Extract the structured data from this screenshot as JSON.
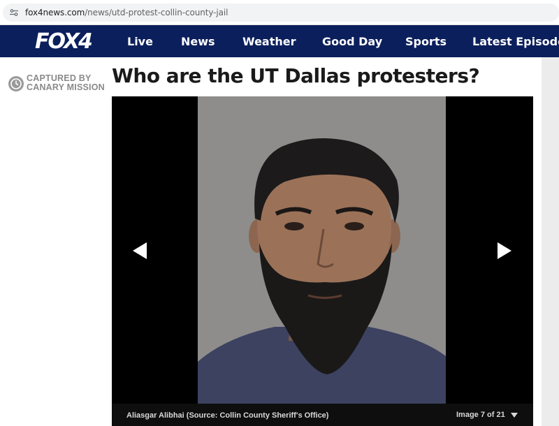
{
  "browser": {
    "url_host": "fox4news.com",
    "url_path": "/news/utd-protest-collin-county-jail"
  },
  "nav": {
    "logo": "FOX4",
    "items": [
      {
        "label": "Live"
      },
      {
        "label": "News"
      },
      {
        "label": "Weather"
      },
      {
        "label": "Good Day"
      },
      {
        "label": "Sports"
      },
      {
        "label": "Latest Episodes"
      }
    ]
  },
  "watermark": {
    "line1": "CAPTURED BY",
    "line2": "CANARY MISSION"
  },
  "article": {
    "headline": "Who are the UT Dallas protesters?"
  },
  "gallery": {
    "caption": "Aliasgar Alibhai (Source: Collin County Sheriff's Office)",
    "counter": "Image 7 of 21"
  },
  "colors": {
    "nav_bg": "#0b1f5c",
    "headline": "#1a1a1a",
    "gallery_bg": "#000000"
  }
}
